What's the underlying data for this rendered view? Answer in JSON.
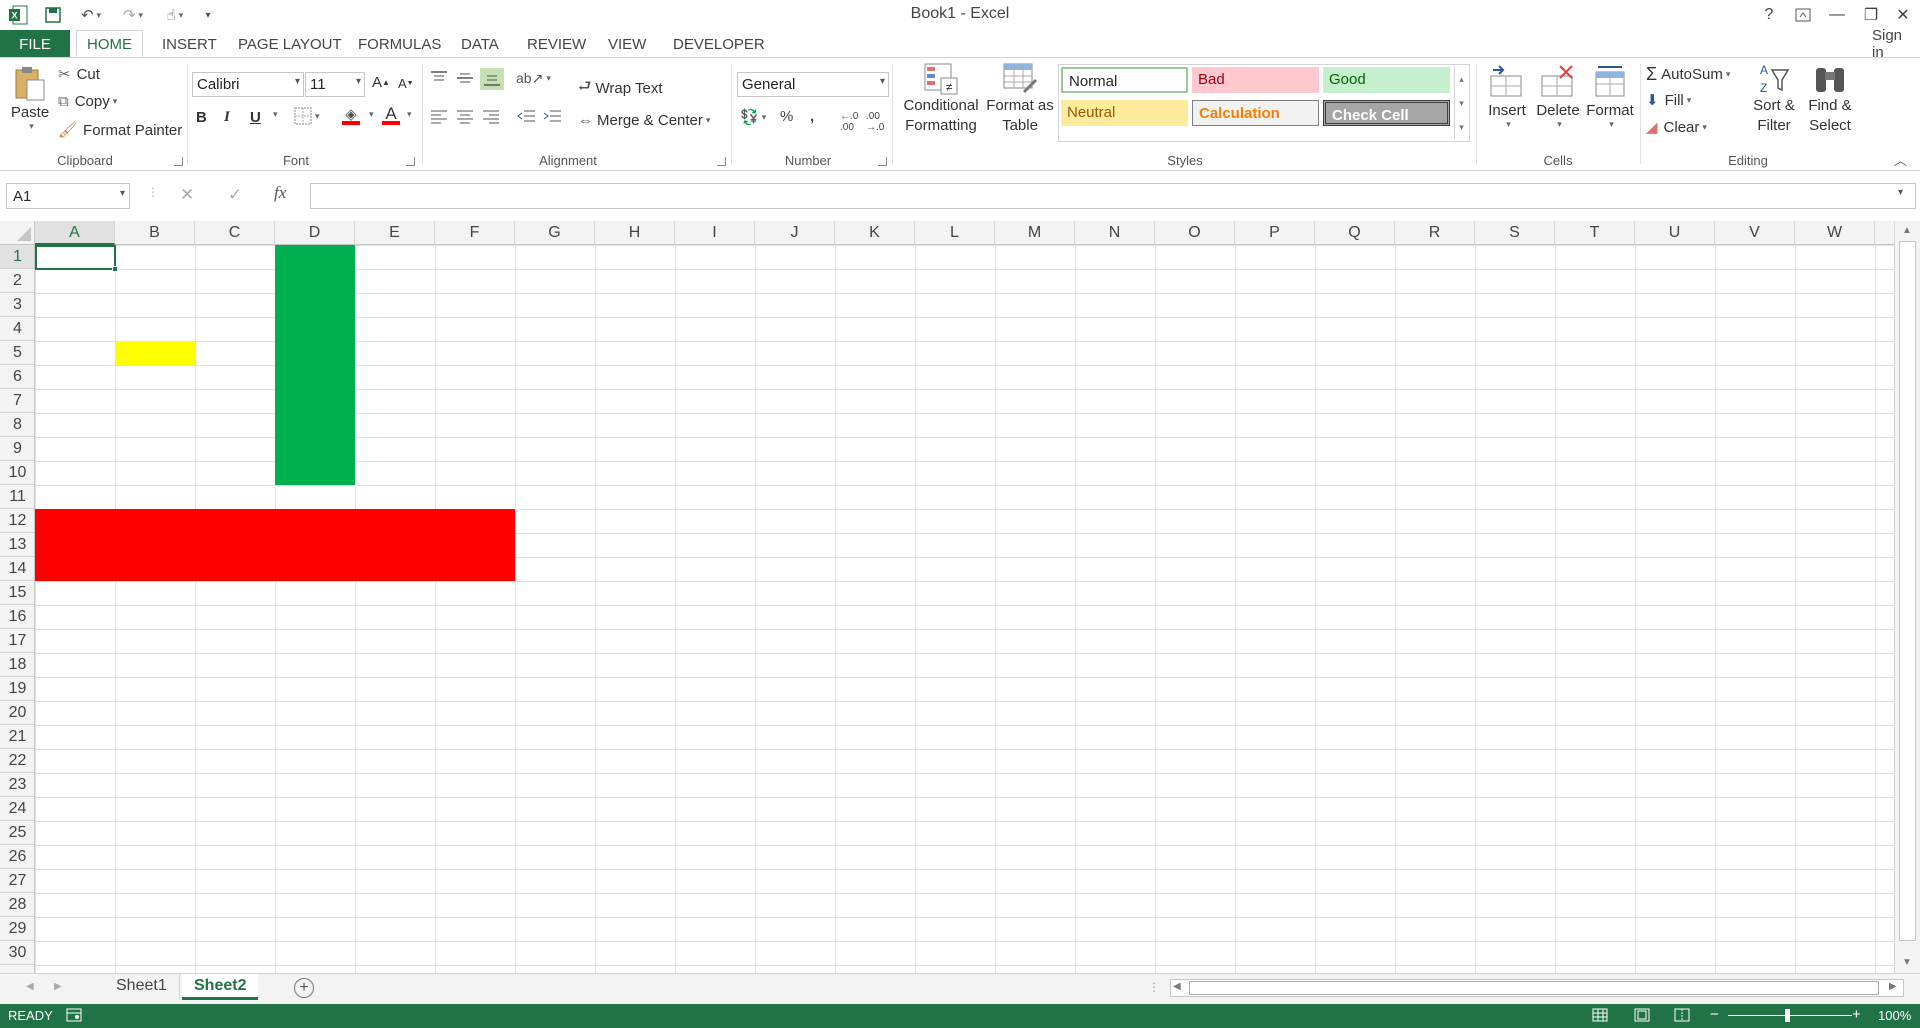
{
  "app": {
    "title": "Book1 - Excel",
    "sign_in": "Sign in",
    "help": "?"
  },
  "tabs": [
    "FILE",
    "HOME",
    "INSERT",
    "PAGE LAYOUT",
    "FORMULAS",
    "DATA",
    "REVIEW",
    "VIEW",
    "DEVELOPER"
  ],
  "ribbon": {
    "clipboard": {
      "label": "Clipboard",
      "paste": "Paste",
      "cut": "Cut",
      "copy": "Copy",
      "format_painter": "Format Painter"
    },
    "font": {
      "label": "Font",
      "font_name": "Calibri",
      "font_size": "11",
      "bold": "B",
      "italic": "I",
      "underline": "U"
    },
    "alignment": {
      "label": "Alignment",
      "wrap_text": "Wrap Text",
      "merge_center": "Merge & Center"
    },
    "number": {
      "label": "Number",
      "format": "General",
      "percent": "%",
      "comma": ","
    },
    "styles": {
      "label": "Styles",
      "conditional_formatting": "Conditional Formatting",
      "format_as_table": "Format as Table",
      "cells": [
        {
          "name": "Normal",
          "bg": "#ffffff",
          "fg": "#000000"
        },
        {
          "name": "Bad",
          "bg": "#ffc7ce",
          "fg": "#9c0006"
        },
        {
          "name": "Good",
          "bg": "#c6efce",
          "fg": "#006100"
        },
        {
          "name": "Neutral",
          "bg": "#ffeb9c",
          "fg": "#9c5700"
        },
        {
          "name": "Calculation",
          "bg": "#f2f2f2",
          "fg": "#fa7d00"
        },
        {
          "name": "Check Cell",
          "bg": "#a5a5a5",
          "fg": "#ffffff"
        }
      ]
    },
    "cells": {
      "label": "Cells",
      "insert": "Insert",
      "delete": "Delete",
      "format": "Format"
    },
    "editing": {
      "label": "Editing",
      "autosum": "AutoSum",
      "fill": "Fill",
      "clear": "Clear",
      "sort_filter": "Sort & Filter",
      "find_select": "Find & Select"
    }
  },
  "formula_bar": {
    "name_box": "A1",
    "fx": "fx",
    "value": ""
  },
  "columns": [
    "A",
    "B",
    "C",
    "D",
    "E",
    "F",
    "G",
    "H",
    "I",
    "J",
    "K",
    "L",
    "M",
    "N",
    "O",
    "P",
    "Q",
    "R",
    "S",
    "T",
    "U",
    "V",
    "W"
  ],
  "rows": [
    "1",
    "2",
    "3",
    "4",
    "5",
    "6",
    "7",
    "8",
    "9",
    "10",
    "11",
    "12",
    "13",
    "14",
    "15",
    "16",
    "17",
    "18",
    "19",
    "20",
    "21",
    "22",
    "23",
    "24",
    "25",
    "26",
    "27",
    "28",
    "29",
    "30"
  ],
  "selected_cell": "A1",
  "filled_ranges": [
    {
      "range": "B5",
      "color": "#ffff00"
    },
    {
      "range": "D1:D10",
      "color": "#00b050"
    },
    {
      "range": "A12:F14",
      "color": "#ff0000"
    }
  ],
  "sheets": [
    "Sheet1",
    "Sheet2"
  ],
  "active_sheet": "Sheet2",
  "status": {
    "mode": "READY",
    "zoom": "100%"
  },
  "colors": {
    "accent": "#217346"
  }
}
